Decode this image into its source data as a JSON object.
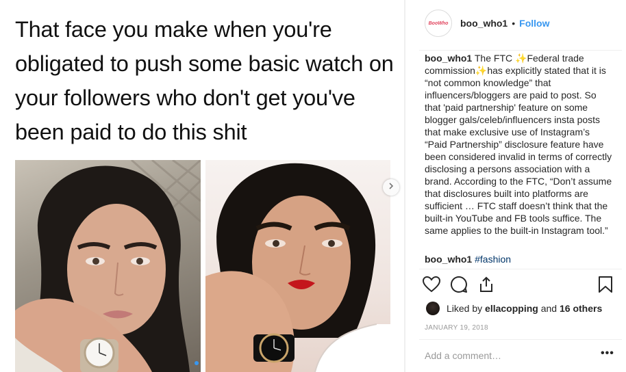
{
  "post": {
    "meme_text": "That face you make when you're obligated to push some basic watch on your followers who don't get you've been paid to do this shit",
    "carousel": {
      "slide_count": 2,
      "active_slide": 1
    }
  },
  "header": {
    "avatar_text": "BooWho",
    "username": "boo_who1",
    "separator": "•",
    "follow_label": "Follow"
  },
  "caption": {
    "username": "boo_who1",
    "p1": "The FTC ",
    "sparkle": "✨",
    "p2": "Federal trade commission",
    "p3": "has explicitly stated that it is “not common knowledge” that influencers/bloggers are paid to post. So that 'paid partnership' feature on some blogger gals/celeb/influencers insta posts that make exclusive use of Instagram’s “Paid Partnership” disclosure feature have been considered invalid in terms of correctly disclosing a persons association with a brand. According to the FTC, “Don’t assume that disclosures built into platforms are sufficient … FTC staff doesn’t think that the built-in YouTube and FB tools suffice. The same applies to the built-in Instagram tool.”"
  },
  "comment": {
    "username": "boo_who1",
    "hashtag": "#fashion"
  },
  "actions": {
    "like_icon": "heart-icon",
    "comment_icon": "comment-icon",
    "share_icon": "share-icon",
    "save_icon": "bookmark-icon"
  },
  "likes": {
    "prefix": "Liked by",
    "user": "ellacopping",
    "and": "and",
    "others": "16 others"
  },
  "date": "JANUARY 19, 2018",
  "add_comment": {
    "placeholder": "Add a comment…",
    "more_label": "•••"
  },
  "colors": {
    "accent": "#3897f0",
    "hashtag": "#003569",
    "muted": "#999999",
    "divider": "#efefef"
  }
}
